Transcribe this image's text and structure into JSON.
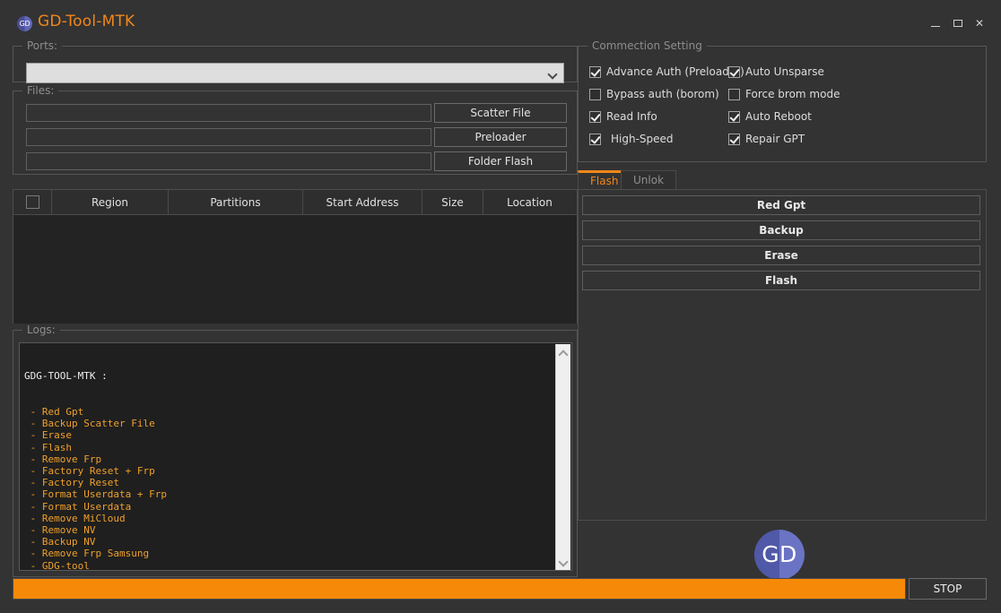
{
  "window": {
    "title": "GD-Tool-MTK",
    "logo_text": "GD",
    "minimize_label": "",
    "maximize_label": "",
    "close_label": "✕"
  },
  "ports": {
    "group_title": "Ports:",
    "selected_value": "",
    "arrow_icon": "chevron-down-icon"
  },
  "files": {
    "group_title": "Files:",
    "rows": [
      {
        "value": "",
        "button": "Scatter File"
      },
      {
        "value": "",
        "button": "Preloader"
      },
      {
        "value": "",
        "button": "Folder Flash"
      }
    ]
  },
  "partition_table": {
    "columns": [
      "Region",
      "Partitions",
      "Start Address",
      "Size",
      "Location"
    ],
    "select_all_checked": false,
    "rows": []
  },
  "logs": {
    "group_title": "Logs:",
    "header": "GDG-TOOL-MTK :",
    "lines": [
      " - Red Gpt",
      " - Backup Scatter File",
      " - Erase",
      " - Flash",
      " - Remove Frp",
      " - Factory Reset + Frp",
      " - Factory Reset",
      " - Format Userdata + Frp",
      " - Format Userdata",
      " - Remove MiCloud",
      " - Remove NV",
      " - Backup NV",
      " - Remove Frp Samsung",
      " - GDG-tool"
    ],
    "scroll_up_icon": "chevron-up-icon",
    "scroll_down_icon": "chevron-down-icon"
  },
  "connection_setting": {
    "group_title": "Commection Setting",
    "left_column": [
      {
        "label": "Advance Auth (Preloader)",
        "checked": true
      },
      {
        "label": "Bypass auth (borom)",
        "checked": false
      },
      {
        "label": "Read Info",
        "checked": true
      },
      {
        "label": "High-Speed",
        "checked": true
      }
    ],
    "right_column": [
      {
        "label": "Auto Unsparse",
        "checked": true
      },
      {
        "label": "Force brom mode",
        "checked": false
      },
      {
        "label": "Auto Reboot",
        "checked": true
      },
      {
        "label": "Repair GPT",
        "checked": true
      }
    ]
  },
  "tabs": [
    {
      "label": "Flash",
      "active": true
    },
    {
      "label": "Unlok",
      "active": false
    }
  ],
  "flash_actions": [
    "Red Gpt",
    "Backup",
    "Erase",
    "Flash"
  ],
  "brand_badge": {
    "text": "GD"
  },
  "status_bar": {
    "progress_percent": 100,
    "stop_label": "STOP"
  },
  "colors": {
    "accent": "#f0871a",
    "progress": "#f68a08",
    "log_text": "#f0a02a",
    "panel_bg": "#333333",
    "table_bg": "#232323",
    "badge_blue": "#5058a8"
  }
}
